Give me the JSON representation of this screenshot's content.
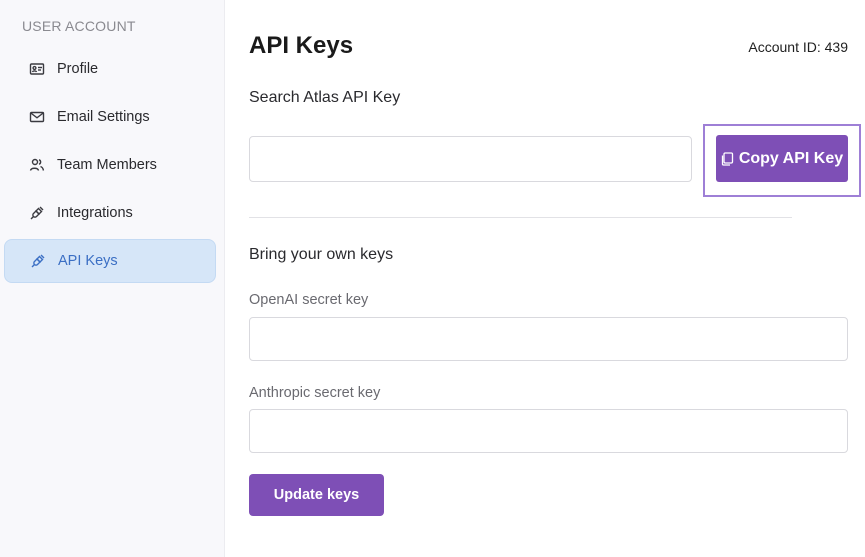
{
  "sidebar": {
    "heading": "USER ACCOUNT",
    "items": [
      {
        "label": "Profile",
        "icon": "id-card-icon"
      },
      {
        "label": "Email Settings",
        "icon": "envelope-icon"
      },
      {
        "label": "Team Members",
        "icon": "users-icon"
      },
      {
        "label": "Integrations",
        "icon": "plug-icon"
      },
      {
        "label": "API Keys",
        "icon": "plug-icon",
        "active": true
      }
    ]
  },
  "main": {
    "title": "API Keys",
    "account_id": "Account ID: 439",
    "search_section": {
      "label": "Search Atlas API Key",
      "input_value": "",
      "copy_button_label": "Copy API Key"
    },
    "byok_section": {
      "label": "Bring your own keys",
      "openai_label": "OpenAI secret key",
      "openai_value": "",
      "anthropic_label": "Anthropic secret key",
      "anthropic_value": "",
      "update_button_label": "Update keys"
    }
  },
  "colors": {
    "accent": "#7e4fb6",
    "active_nav_bg": "#d6e6f8",
    "active_nav_text": "#3b6fc4"
  }
}
